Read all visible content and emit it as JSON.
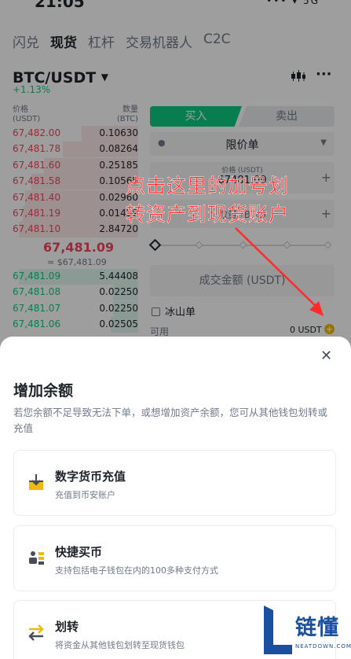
{
  "status_bar": {
    "time": "21:05",
    "icons": "••• ▾ 5G"
  },
  "top_tabs": [
    "闪兑",
    "现货",
    "杠杆",
    "交易机器人",
    "C2C"
  ],
  "active_tab": "现货",
  "pair": {
    "symbol": "BTC/USDT",
    "change": "+1.13%"
  },
  "order_book": {
    "header_price": "价格",
    "header_price_unit": "(USDT)",
    "header_qty": "数量",
    "header_qty_unit": "(BTC)",
    "asks": [
      {
        "price": "67,482.00",
        "qty": "0.10630",
        "depth": 0.45
      },
      {
        "price": "67,481.78",
        "qty": "0.08264",
        "depth": 0.6
      },
      {
        "price": "67,481.60",
        "qty": "0.25185",
        "depth": 0.75
      },
      {
        "price": "67,481.58",
        "qty": "0.10565",
        "depth": 0.85
      },
      {
        "price": "67,481.40",
        "qty": "0.02960",
        "depth": 0.9
      },
      {
        "price": "67,481.19",
        "qty": "0.01459",
        "depth": 0.92
      },
      {
        "price": "67,481.10",
        "qty": "2.84720",
        "depth": 0.95
      }
    ],
    "mid_price": "67,481.09",
    "mid_fiat": "≈ $67,481.09",
    "bids": [
      {
        "price": "67,481.09",
        "qty": "5.44408",
        "depth": 0.95
      },
      {
        "price": "67,481.08",
        "qty": "0.02250",
        "depth": 0.2
      },
      {
        "price": "67,481.07",
        "qty": "0.02250",
        "depth": 0.2
      },
      {
        "price": "67,481.06",
        "qty": "0.02505",
        "depth": 0.22
      }
    ]
  },
  "trade_panel": {
    "buy_label": "买入",
    "sell_label": "卖出",
    "order_type": "限价单",
    "price_label": "价格 (USDT)",
    "price_value": "67481.09",
    "qty_placeholder": "数量 (BTC)",
    "total_placeholder": "成交金额 (USDT)",
    "iceberg_label": "冰山单",
    "available_label": "可用",
    "available_value": "0 USDT"
  },
  "annotation": {
    "line1": "点击这里的加号划",
    "line2": "转资产到现货账户"
  },
  "sheet": {
    "title": "增加余额",
    "description": "若您余额不足导致无法下单，或想增加资产余额，您可从其他钱包划转或充值",
    "options": [
      {
        "title": "数字货币充值",
        "subtitle": "充值到币安账户",
        "icon": "deposit-icon"
      },
      {
        "title": "快捷买币",
        "subtitle": "支持包括电子钱包在内的100多种支付方式",
        "icon": "buy-crypto-icon"
      },
      {
        "title": "划转",
        "subtitle": "将资金从其他钱包划转至现货钱包",
        "icon": "transfer-icon"
      }
    ]
  },
  "watermark": {
    "text": "链懂",
    "sub": "NEATDOWN.COM"
  },
  "colors": {
    "buy": "#0ecb81",
    "sell": "#f6465d",
    "brand": "#f0b90b",
    "annotation": "#ff2a2a"
  }
}
